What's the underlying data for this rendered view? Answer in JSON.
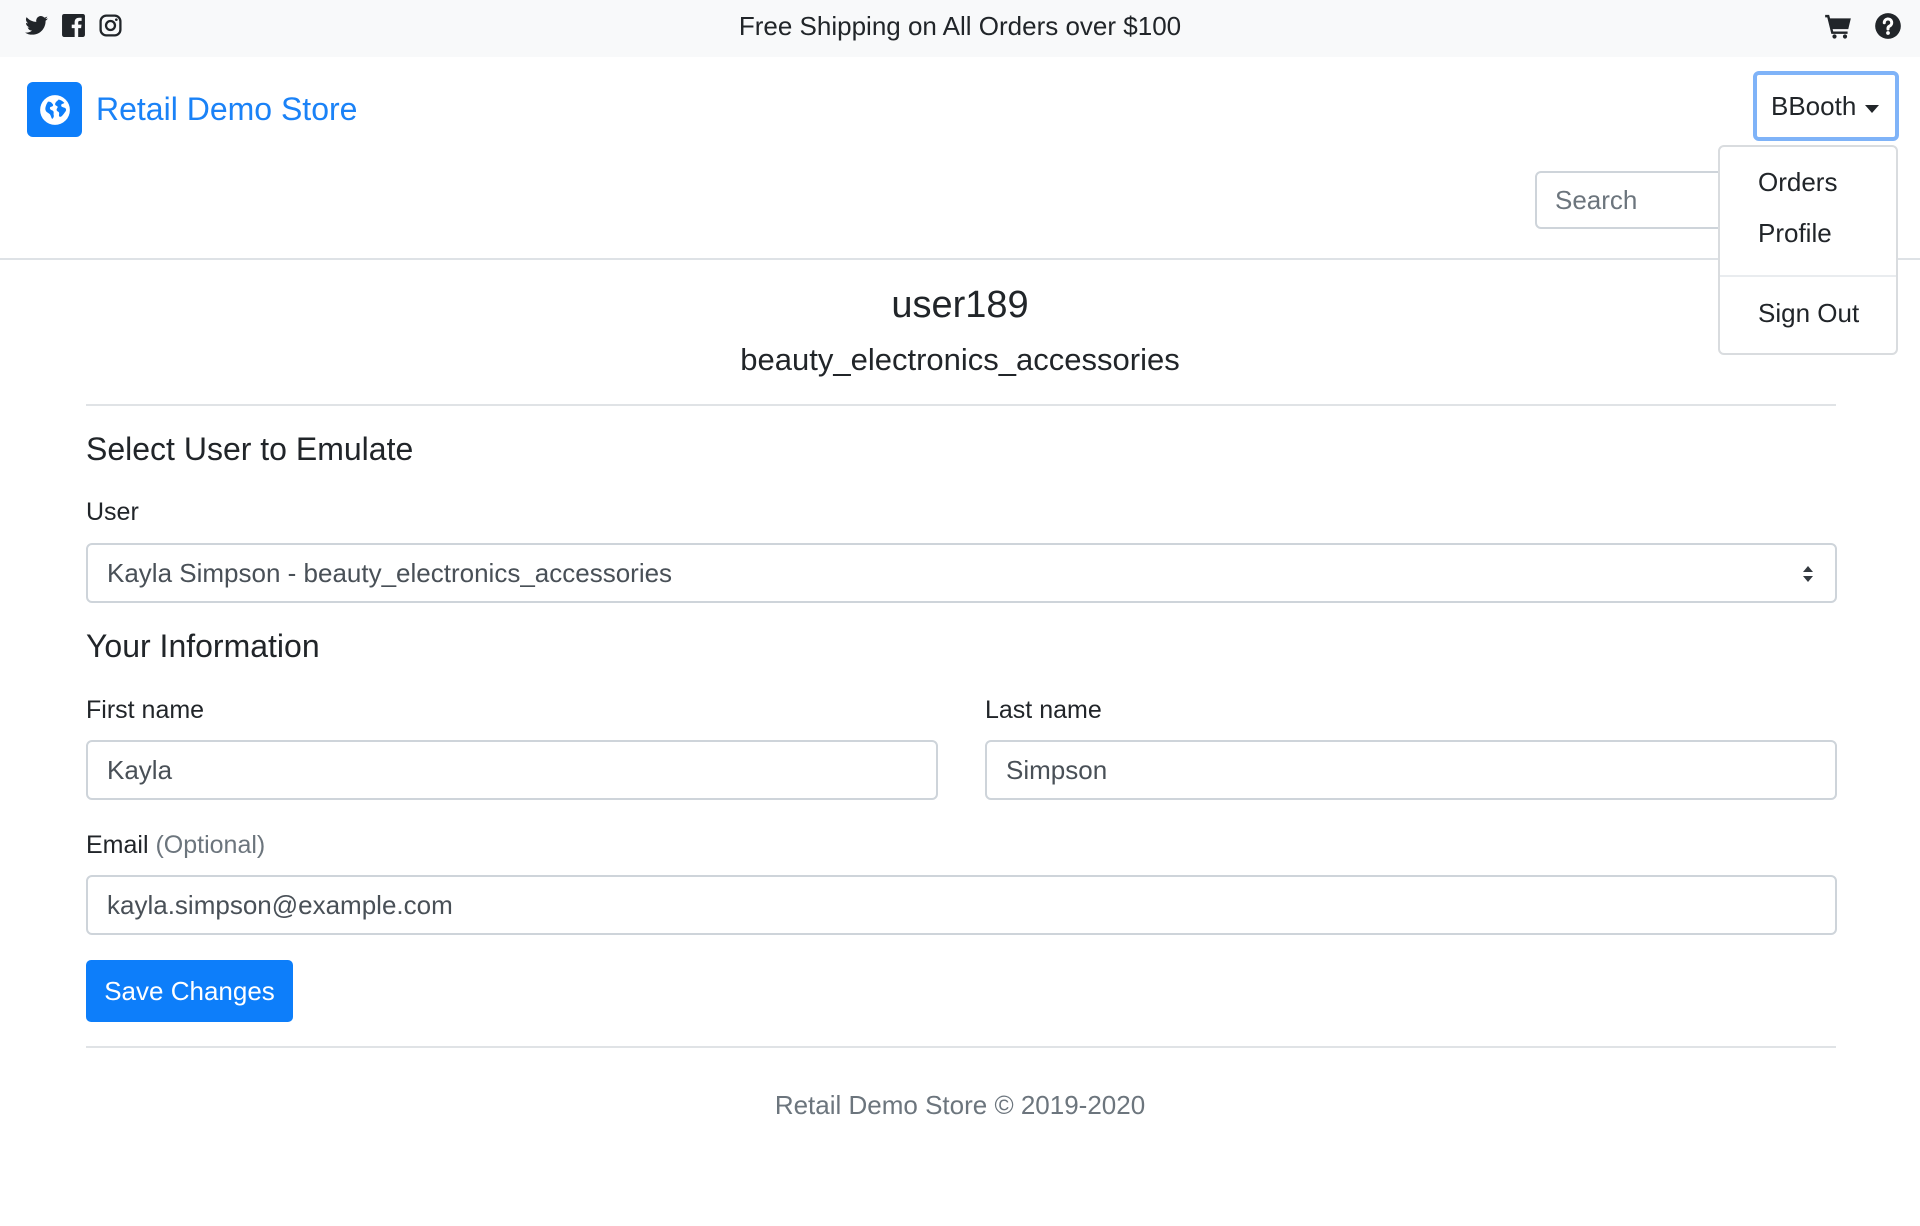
{
  "topbar": {
    "promo": "Free Shipping on All Orders over $100",
    "social_icons": [
      "twitter-icon",
      "facebook-icon",
      "instagram-icon"
    ],
    "right_icons": [
      "cart-icon",
      "help-icon"
    ]
  },
  "navbar": {
    "brand": "Retail Demo Store",
    "brand_icon": "globe-icon",
    "user_menu_label": "BBooth",
    "search_placeholder": "Search"
  },
  "user_menu": {
    "items": [
      "Orders",
      "Profile"
    ],
    "sign_out": "Sign Out"
  },
  "profile": {
    "username": "user189",
    "segment": "beauty_electronics_accessories"
  },
  "emulate": {
    "heading": "Select User to Emulate",
    "user_label": "User",
    "selected_user": "Kayla Simpson - beauty_electronics_accessories"
  },
  "info": {
    "heading": "Your Information",
    "first_name_label": "First name",
    "first_name_value": "Kayla",
    "last_name_label": "Last name",
    "last_name_value": "Simpson",
    "email_label": "Email",
    "email_optional": "(Optional)",
    "email_value": "kayla.simpson@example.com",
    "save_label": "Save Changes"
  },
  "footer": {
    "text": "Retail Demo Store © 2019-2020"
  },
  "colors": {
    "primary": "#0d7efa",
    "brand_text": "#1a82f7",
    "topbar_bg": "#f8f9fa",
    "muted_text": "#6c757d"
  }
}
